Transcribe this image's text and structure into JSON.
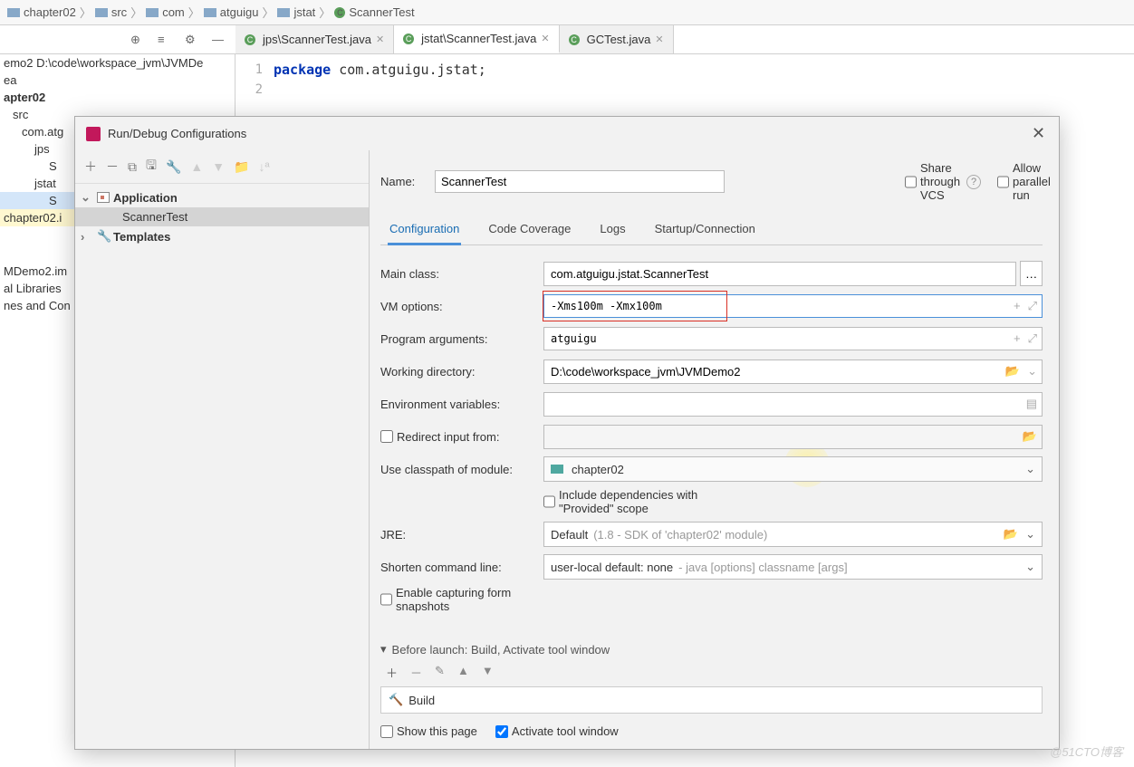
{
  "breadcrumb": [
    "chapter02",
    "src",
    "com",
    "atguigu",
    "jstat",
    "ScannerTest"
  ],
  "editor_tabs": [
    {
      "label": "jps\\ScannerTest.java",
      "active": false
    },
    {
      "label": "jstat\\ScannerTest.java",
      "active": true
    },
    {
      "label": "GCTest.java",
      "active": false
    }
  ],
  "gutter_lines": [
    "1",
    "2"
  ],
  "code": {
    "kw": "package",
    "rest": " com.atguigu.jstat;"
  },
  "project_panel": {
    "lines": [
      "emo2  D:\\code\\workspace_jvm\\JVMDe",
      "ea",
      "apter02",
      "src",
      "com.atg",
      "jps",
      "S",
      "jstat",
      "S",
      "chapter02.i",
      "MDemo2.im",
      "al Libraries",
      "nes and Con"
    ]
  },
  "dialog": {
    "title": "Run/Debug Configurations",
    "sidebar": {
      "application": "Application",
      "scanner": "ScannerTest",
      "templates": "Templates"
    },
    "form": {
      "name_label": "Name:",
      "name_value": "ScannerTest",
      "share_label": "Share through VCS",
      "parallel_label": "Allow parallel run",
      "tabs": [
        "Configuration",
        "Code Coverage",
        "Logs",
        "Startup/Connection"
      ],
      "main_class_label": "Main class:",
      "main_class_value": "com.atguigu.jstat.ScannerTest",
      "vm_label": "VM options:",
      "vm_value": "-Xms100m -Xmx100m",
      "prog_label": "Program arguments:",
      "prog_value": "atguigu",
      "wd_label": "Working directory:",
      "wd_value": "D:\\code\\workspace_jvm\\JVMDemo2",
      "env_label": "Environment variables:",
      "env_value": "",
      "redirect_label": "Redirect input from:",
      "classpath_label": "Use classpath of module:",
      "classpath_value": "chapter02",
      "include_deps": "Include dependencies with \"Provided\" scope",
      "jre_label": "JRE:",
      "jre_value": "Default",
      "jre_hint": " (1.8 - SDK of 'chapter02' module)",
      "shorten_label": "Shorten command line:",
      "shorten_value": "user-local default: none",
      "shorten_hint": " - java [options] classname [args]",
      "enable_snap": "Enable capturing form snapshots",
      "before_launch": "Before launch: Build, Activate tool window",
      "build_task": "Build",
      "show_page": "Show this page",
      "activate_tw": "Activate tool window"
    }
  },
  "watermark": "@51CTO博客"
}
